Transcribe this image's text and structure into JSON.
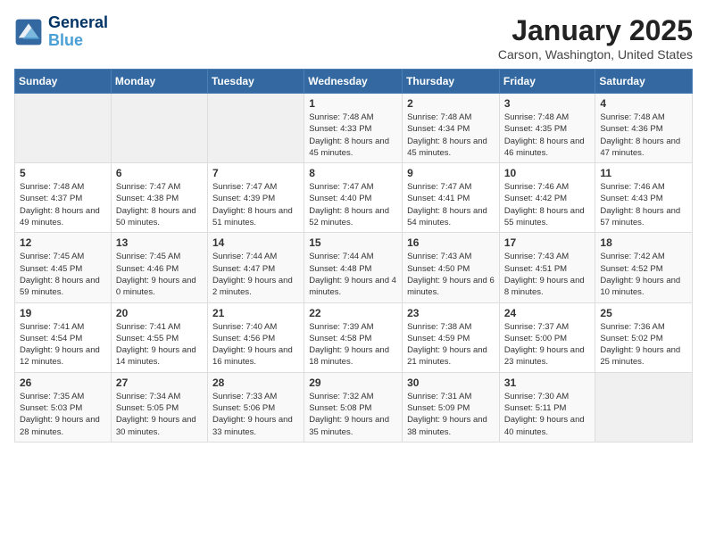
{
  "header": {
    "logo_line1": "General",
    "logo_line2": "Blue",
    "month": "January 2025",
    "location": "Carson, Washington, United States"
  },
  "days_of_week": [
    "Sunday",
    "Monday",
    "Tuesday",
    "Wednesday",
    "Thursday",
    "Friday",
    "Saturday"
  ],
  "weeks": [
    [
      {
        "day": "",
        "sunrise": "",
        "sunset": "",
        "daylight": ""
      },
      {
        "day": "",
        "sunrise": "",
        "sunset": "",
        "daylight": ""
      },
      {
        "day": "",
        "sunrise": "",
        "sunset": "",
        "daylight": ""
      },
      {
        "day": "1",
        "sunrise": "Sunrise: 7:48 AM",
        "sunset": "Sunset: 4:33 PM",
        "daylight": "Daylight: 8 hours and 45 minutes."
      },
      {
        "day": "2",
        "sunrise": "Sunrise: 7:48 AM",
        "sunset": "Sunset: 4:34 PM",
        "daylight": "Daylight: 8 hours and 45 minutes."
      },
      {
        "day": "3",
        "sunrise": "Sunrise: 7:48 AM",
        "sunset": "Sunset: 4:35 PM",
        "daylight": "Daylight: 8 hours and 46 minutes."
      },
      {
        "day": "4",
        "sunrise": "Sunrise: 7:48 AM",
        "sunset": "Sunset: 4:36 PM",
        "daylight": "Daylight: 8 hours and 47 minutes."
      }
    ],
    [
      {
        "day": "5",
        "sunrise": "Sunrise: 7:48 AM",
        "sunset": "Sunset: 4:37 PM",
        "daylight": "Daylight: 8 hours and 49 minutes."
      },
      {
        "day": "6",
        "sunrise": "Sunrise: 7:47 AM",
        "sunset": "Sunset: 4:38 PM",
        "daylight": "Daylight: 8 hours and 50 minutes."
      },
      {
        "day": "7",
        "sunrise": "Sunrise: 7:47 AM",
        "sunset": "Sunset: 4:39 PM",
        "daylight": "Daylight: 8 hours and 51 minutes."
      },
      {
        "day": "8",
        "sunrise": "Sunrise: 7:47 AM",
        "sunset": "Sunset: 4:40 PM",
        "daylight": "Daylight: 8 hours and 52 minutes."
      },
      {
        "day": "9",
        "sunrise": "Sunrise: 7:47 AM",
        "sunset": "Sunset: 4:41 PM",
        "daylight": "Daylight: 8 hours and 54 minutes."
      },
      {
        "day": "10",
        "sunrise": "Sunrise: 7:46 AM",
        "sunset": "Sunset: 4:42 PM",
        "daylight": "Daylight: 8 hours and 55 minutes."
      },
      {
        "day": "11",
        "sunrise": "Sunrise: 7:46 AM",
        "sunset": "Sunset: 4:43 PM",
        "daylight": "Daylight: 8 hours and 57 minutes."
      }
    ],
    [
      {
        "day": "12",
        "sunrise": "Sunrise: 7:45 AM",
        "sunset": "Sunset: 4:45 PM",
        "daylight": "Daylight: 8 hours and 59 minutes."
      },
      {
        "day": "13",
        "sunrise": "Sunrise: 7:45 AM",
        "sunset": "Sunset: 4:46 PM",
        "daylight": "Daylight: 9 hours and 0 minutes."
      },
      {
        "day": "14",
        "sunrise": "Sunrise: 7:44 AM",
        "sunset": "Sunset: 4:47 PM",
        "daylight": "Daylight: 9 hours and 2 minutes."
      },
      {
        "day": "15",
        "sunrise": "Sunrise: 7:44 AM",
        "sunset": "Sunset: 4:48 PM",
        "daylight": "Daylight: 9 hours and 4 minutes."
      },
      {
        "day": "16",
        "sunrise": "Sunrise: 7:43 AM",
        "sunset": "Sunset: 4:50 PM",
        "daylight": "Daylight: 9 hours and 6 minutes."
      },
      {
        "day": "17",
        "sunrise": "Sunrise: 7:43 AM",
        "sunset": "Sunset: 4:51 PM",
        "daylight": "Daylight: 9 hours and 8 minutes."
      },
      {
        "day": "18",
        "sunrise": "Sunrise: 7:42 AM",
        "sunset": "Sunset: 4:52 PM",
        "daylight": "Daylight: 9 hours and 10 minutes."
      }
    ],
    [
      {
        "day": "19",
        "sunrise": "Sunrise: 7:41 AM",
        "sunset": "Sunset: 4:54 PM",
        "daylight": "Daylight: 9 hours and 12 minutes."
      },
      {
        "day": "20",
        "sunrise": "Sunrise: 7:41 AM",
        "sunset": "Sunset: 4:55 PM",
        "daylight": "Daylight: 9 hours and 14 minutes."
      },
      {
        "day": "21",
        "sunrise": "Sunrise: 7:40 AM",
        "sunset": "Sunset: 4:56 PM",
        "daylight": "Daylight: 9 hours and 16 minutes."
      },
      {
        "day": "22",
        "sunrise": "Sunrise: 7:39 AM",
        "sunset": "Sunset: 4:58 PM",
        "daylight": "Daylight: 9 hours and 18 minutes."
      },
      {
        "day": "23",
        "sunrise": "Sunrise: 7:38 AM",
        "sunset": "Sunset: 4:59 PM",
        "daylight": "Daylight: 9 hours and 21 minutes."
      },
      {
        "day": "24",
        "sunrise": "Sunrise: 7:37 AM",
        "sunset": "Sunset: 5:00 PM",
        "daylight": "Daylight: 9 hours and 23 minutes."
      },
      {
        "day": "25",
        "sunrise": "Sunrise: 7:36 AM",
        "sunset": "Sunset: 5:02 PM",
        "daylight": "Daylight: 9 hours and 25 minutes."
      }
    ],
    [
      {
        "day": "26",
        "sunrise": "Sunrise: 7:35 AM",
        "sunset": "Sunset: 5:03 PM",
        "daylight": "Daylight: 9 hours and 28 minutes."
      },
      {
        "day": "27",
        "sunrise": "Sunrise: 7:34 AM",
        "sunset": "Sunset: 5:05 PM",
        "daylight": "Daylight: 9 hours and 30 minutes."
      },
      {
        "day": "28",
        "sunrise": "Sunrise: 7:33 AM",
        "sunset": "Sunset: 5:06 PM",
        "daylight": "Daylight: 9 hours and 33 minutes."
      },
      {
        "day": "29",
        "sunrise": "Sunrise: 7:32 AM",
        "sunset": "Sunset: 5:08 PM",
        "daylight": "Daylight: 9 hours and 35 minutes."
      },
      {
        "day": "30",
        "sunrise": "Sunrise: 7:31 AM",
        "sunset": "Sunset: 5:09 PM",
        "daylight": "Daylight: 9 hours and 38 minutes."
      },
      {
        "day": "31",
        "sunrise": "Sunrise: 7:30 AM",
        "sunset": "Sunset: 5:11 PM",
        "daylight": "Daylight: 9 hours and 40 minutes."
      },
      {
        "day": "",
        "sunrise": "",
        "sunset": "",
        "daylight": ""
      }
    ]
  ]
}
